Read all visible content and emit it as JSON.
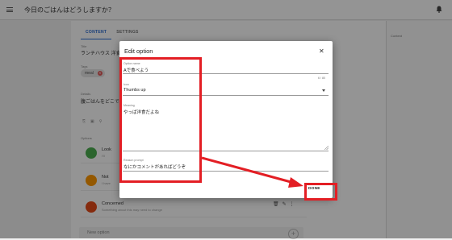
{
  "app": {
    "title": "今日のごはんはどうしますか？"
  },
  "tabs": [
    {
      "label": "CONTENT"
    },
    {
      "label": "SETTINGS"
    }
  ],
  "right_panel": {
    "label": "Content"
  },
  "form": {
    "title_label": "Title",
    "title_value": "ランチハウス 洋食",
    "tags_label": "Tags",
    "tag": "meal",
    "details_label": "Details",
    "details_value": "腹ごはんをどこで食",
    "options_label": "Options"
  },
  "options": [
    {
      "title": "Look",
      "subtitle": "I'll",
      "color": "#4caf50",
      "icon": "thumbs-up-icon"
    },
    {
      "title": "Not",
      "subtitle": "I have",
      "color": "#ff9800",
      "icon": "hand-icon"
    },
    {
      "title": "Concerned",
      "subtitle": "Something about this may need to change",
      "color": "#e64a19",
      "icon": "thumbs-down-icon"
    }
  ],
  "new_option": {
    "placeholder": "New option"
  },
  "dialog": {
    "title": "Edit option",
    "option_name_label": "Option name",
    "option_name_value": "Aで食べよう",
    "char_count": "6 / 80",
    "icon_label": "Icon",
    "icon_value": "Thumbs up",
    "meaning_label": "Meaning",
    "meaning_value": "やっぱ洋食だよね",
    "reason_label": "Reason prompt",
    "reason_value": "なにかコメントがあればどうぞ",
    "done_label": "DONE"
  },
  "colors": {
    "accent": "#2a6bd2",
    "highlight": "#e31e24"
  }
}
